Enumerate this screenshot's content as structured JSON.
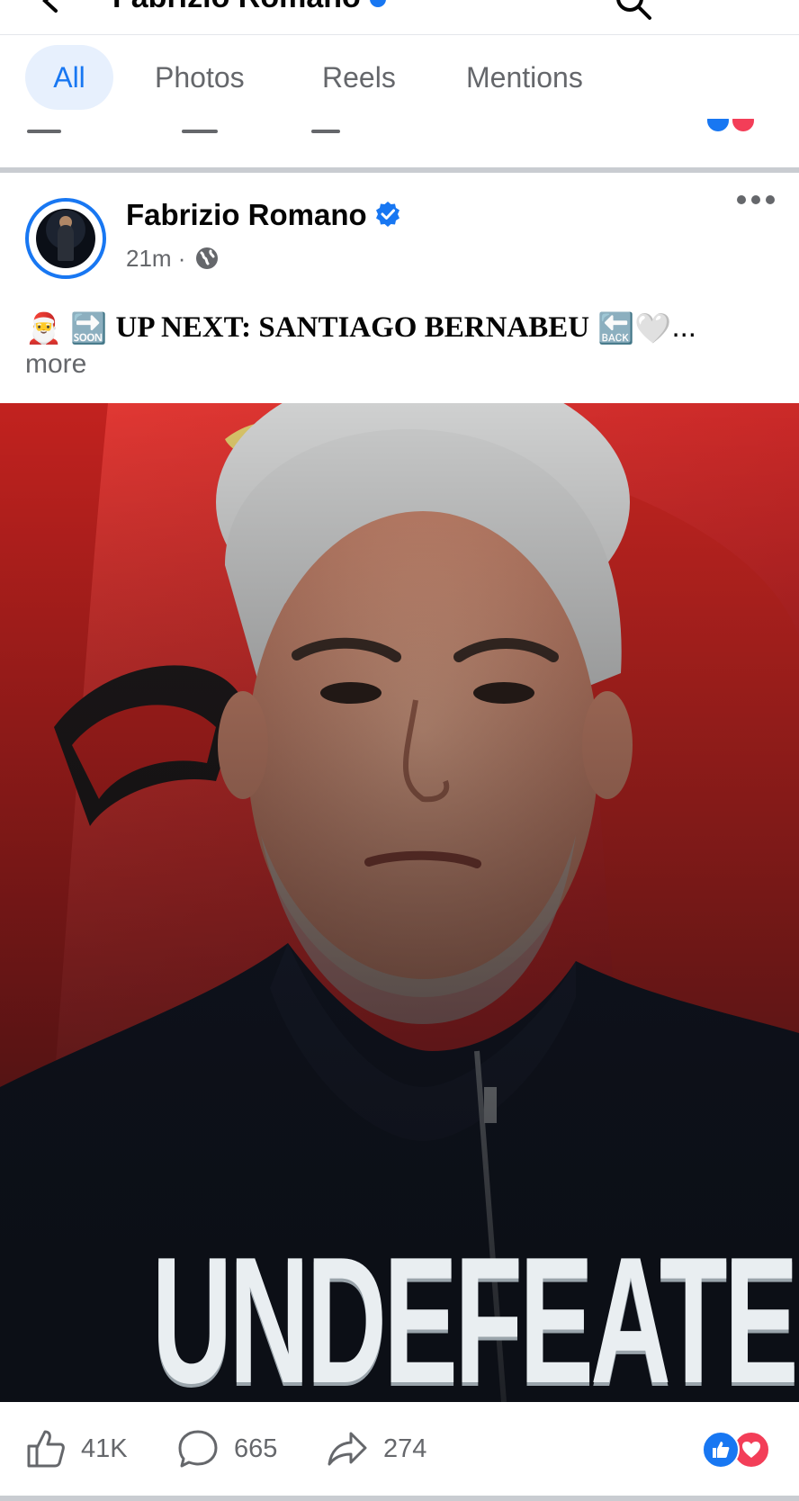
{
  "header": {
    "title": "Fabrizio Romano"
  },
  "tabs": [
    {
      "label": "All",
      "active": true
    },
    {
      "label": "Photos",
      "active": false
    },
    {
      "label": "Reels",
      "active": false
    },
    {
      "label": "Mentions",
      "active": false
    }
  ],
  "post": {
    "author": "Fabrizio Romano",
    "verified": true,
    "time": "21m",
    "audience_icon": "globe-icon",
    "caption_emoji_lead": "🎅 🔜",
    "caption": "UP NEXT: SANTIAGO BERNABEU",
    "caption_emoji_tail": "🔙🤍",
    "caption_ellipsis": "...",
    "more_label": "more",
    "image_headline": "UNDEFEATED"
  },
  "actions": {
    "likes": "41K",
    "comments": "665",
    "shares": "274"
  },
  "colors": {
    "accent": "#1877f2",
    "love": "#f33e58",
    "tab_active_bg": "#e7f0fd",
    "muted": "#65676b"
  }
}
